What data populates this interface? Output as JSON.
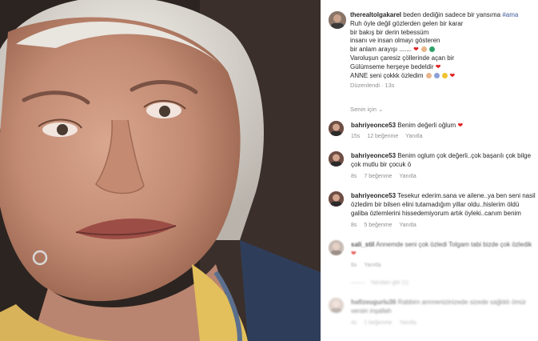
{
  "post": {
    "author": "therealtolgakarel",
    "caption_lines": [
      "beden dediğin sadece bir yansıma",
      "Ruh öyle değil gözlerden gelen bir karar",
      "bir bakış bir derin tebessüm",
      "insanı ve insan olmayı gösteren",
      "bir anlam arayışı .......",
      "Varoluşun çaresiz çöllerinde açan bir",
      "Gülümseme herşeye bedeldir",
      "ANNE seni çokkk özledim"
    ],
    "hashtag": "#ama",
    "edited_label": "Düzenlendi · 13s",
    "see_translation": "Senin için"
  },
  "comments": [
    {
      "user": "bahriyeonce53",
      "text": "Benim değerli oğlum",
      "time": "15s",
      "likes": "12 beğenme",
      "reply": "Yanıtla"
    },
    {
      "user": "bahriyeonce53",
      "text": "Benim oglum çok değerli..çok başarılı çok bilge çok mutlu bir çocuk ö",
      "time": "8s",
      "likes": "7 beğenme",
      "reply": "Yanıtla"
    },
    {
      "user": "bahriyeonce53",
      "text": "Tesekur ederim.sana ve ailene..ya ben seni nasil özledim bir bilsen elini tutamadığım yillar oldu..hislerim öldü galiba özlemlerini hissedemiyorum artık öyleki..canım benim",
      "time": "8s",
      "likes": "5 beğenme",
      "reply": "Yanıtla"
    },
    {
      "user": "sali_stil",
      "text": "Annemde seni çok özledi Tolgam tabi bizde çok özledik",
      "time": "6s",
      "likes": "",
      "reply": "Yanıtla"
    },
    {
      "user": "hafizeugurlu36",
      "text": "Rabbim annnenizinizede sizede sağlıklı ömür versin inşallah",
      "time": "4s",
      "likes": "1 beğenme",
      "reply": "Yanıtla"
    }
  ],
  "view_replies": "Yanıtları gör (1)",
  "colors": {
    "accent": "#3d5a99",
    "heart": "#e02020",
    "muted": "#8e8e8e"
  }
}
